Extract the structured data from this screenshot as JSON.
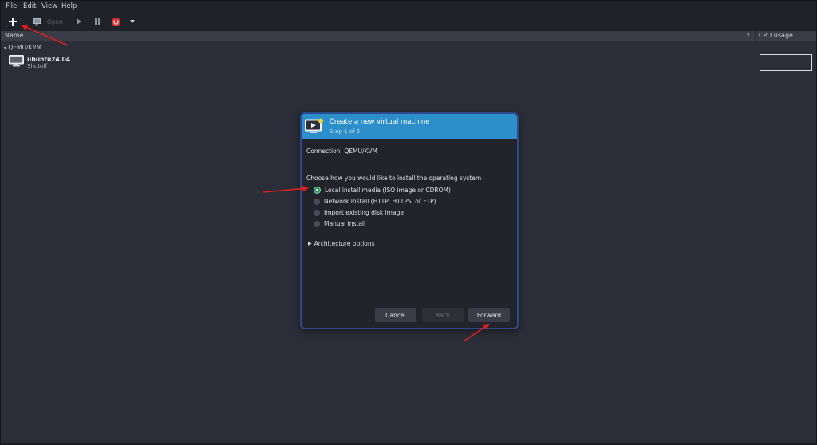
{
  "menu": [
    "File",
    "Edit",
    "View",
    "Help"
  ],
  "toolbar": {
    "open_label": "Open"
  },
  "list": {
    "col_name": "Name",
    "col_cpu": "CPU usage",
    "group": "QEMU/KVM",
    "vm": {
      "name": "ubuntu24.04",
      "status": "Shutoff"
    }
  },
  "dialog": {
    "title": "Create a new virtual machine",
    "step": "Step 1 of 5",
    "connection": "Connection:  QEMU/KVM",
    "prompt": "Choose how you would like to install the operating system",
    "options": [
      {
        "label": "Local install media (ISO image or CDROM)",
        "selected": true
      },
      {
        "label": "Network Install (HTTP, HTTPS, or FTP)",
        "selected": false
      },
      {
        "label": "Import existing disk image",
        "selected": false
      },
      {
        "label": "Manual install",
        "selected": false
      }
    ],
    "arch_label": "Architecture options",
    "buttons": {
      "cancel": "Cancel",
      "back": "Back",
      "forward": "Forward"
    }
  },
  "colors": {
    "header_blue": "#2c8fc9",
    "annotation_red": "#e0201c",
    "power_red": "#d32f2f"
  },
  "icons": [
    "plus-icon",
    "monitor-icon",
    "play-icon",
    "pause-icon",
    "power-icon",
    "chevron-down-icon",
    "vm-monitor-icon",
    "new-vm-icon",
    "radio-icon",
    "expander-triangle-icon"
  ]
}
